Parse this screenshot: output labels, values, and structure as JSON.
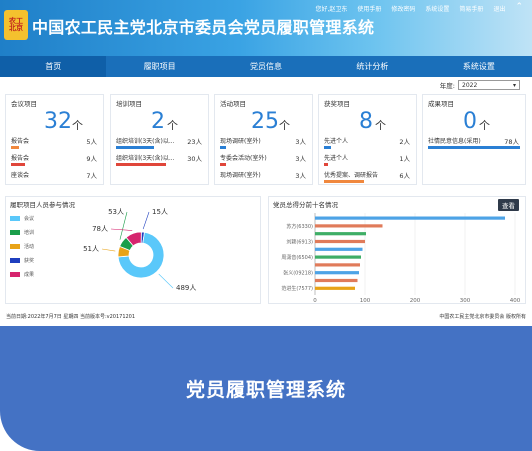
{
  "header": {
    "logo_text": "农工\n北京",
    "title": "中国农工民主党北京市委员会党员履职管理系统",
    "top_links": [
      "您好,赵卫东",
      "使用手册",
      "修改密码",
      "系统设置",
      "简易手册",
      "退出"
    ]
  },
  "nav": {
    "items": [
      "首页",
      "履职项目",
      "党员信息",
      "统计分析",
      "系统设置"
    ]
  },
  "year": {
    "label": "年度:",
    "value": "2022"
  },
  "cards": {
    "meeting": {
      "title": "会议项目",
      "count": "32",
      "unit": "个",
      "rows": [
        {
          "label": "报告会",
          "value": "5人"
        },
        {
          "label": "报告会",
          "value": "9人"
        },
        {
          "label": "座谈会",
          "value": "7人"
        }
      ]
    },
    "training": {
      "title": "培训项目",
      "count": "2",
      "unit": "个",
      "rows": [
        {
          "label": "组织培训(3天(含)以...",
          "value": "23人"
        },
        {
          "label": "组织培训(3天(含)以...",
          "value": "30人"
        }
      ]
    },
    "activity": {
      "title": "活动项目",
      "count": "25",
      "unit": "个",
      "rows": [
        {
          "label": "现场调研(室外)",
          "value": "3人"
        },
        {
          "label": "专委会活动(室外)",
          "value": "3人"
        },
        {
          "label": "现场调研(室外)",
          "value": "3人"
        }
      ]
    },
    "award": {
      "title": "获奖项目",
      "count": "8",
      "unit": "个",
      "rows": [
        {
          "label": "先进个人",
          "value": "2人"
        },
        {
          "label": "先进个人",
          "value": "1人"
        },
        {
          "label": "优秀提案、调研报告",
          "value": "6人"
        }
      ]
    },
    "achievement": {
      "title": "成果项目",
      "count": "0",
      "unit": "个",
      "rows": [
        {
          "label": "社情民意信息(采用)",
          "value": "78人"
        }
      ]
    }
  },
  "pie_panel": {
    "title": "履职项目人员参与情况",
    "legend": [
      "会议",
      "培训",
      "活动",
      "获奖",
      "成果"
    ]
  },
  "bar_panel": {
    "title": "党员总得分前十名情况",
    "view_button": "查看"
  },
  "colors": {
    "meeting": "#5ac8fa",
    "training": "#1a9e4a",
    "activity": "#e8a317",
    "award": "#1f3fbf",
    "achievement": "#d6246e"
  },
  "chart_data": [
    {
      "type": "pie",
      "title": "履职项目人员参与情况",
      "categories": [
        "会议",
        "培训",
        "活动",
        "获奖",
        "成果"
      ],
      "values": [
        489,
        53,
        51,
        15,
        78
      ],
      "labels": [
        "489人",
        "53人",
        "51人",
        "15人",
        "78人"
      ]
    },
    {
      "type": "bar",
      "title": "党员总得分前十名情况",
      "categories": [
        "",
        "苏方(6330)",
        "",
        "刘颖(6913)",
        "",
        "周潇音(6504)",
        "",
        "张义(09218)",
        "",
        "范进生(7577)"
      ],
      "values": [
        380,
        135,
        102,
        100,
        95,
        92,
        90,
        88,
        85,
        80
      ],
      "bar_colors": [
        "#4da3e6",
        "#e07b5a",
        "#3fae66",
        "#e07b5a",
        "#4da3e6",
        "#3fae66",
        "#e07b5a",
        "#4da3e6",
        "#e07b5a",
        "#e8a317"
      ],
      "xticks": [
        "0",
        "100",
        "200",
        "300",
        "400"
      ],
      "xlim": [
        0,
        400
      ]
    }
  ],
  "footer": {
    "left": "当前日期:2022年7月7日 星期四   当前版本号:v20171201",
    "right": "中国农工民主党北京市委员会 版权所有"
  },
  "banner": {
    "title": "党员履职管理系统"
  }
}
